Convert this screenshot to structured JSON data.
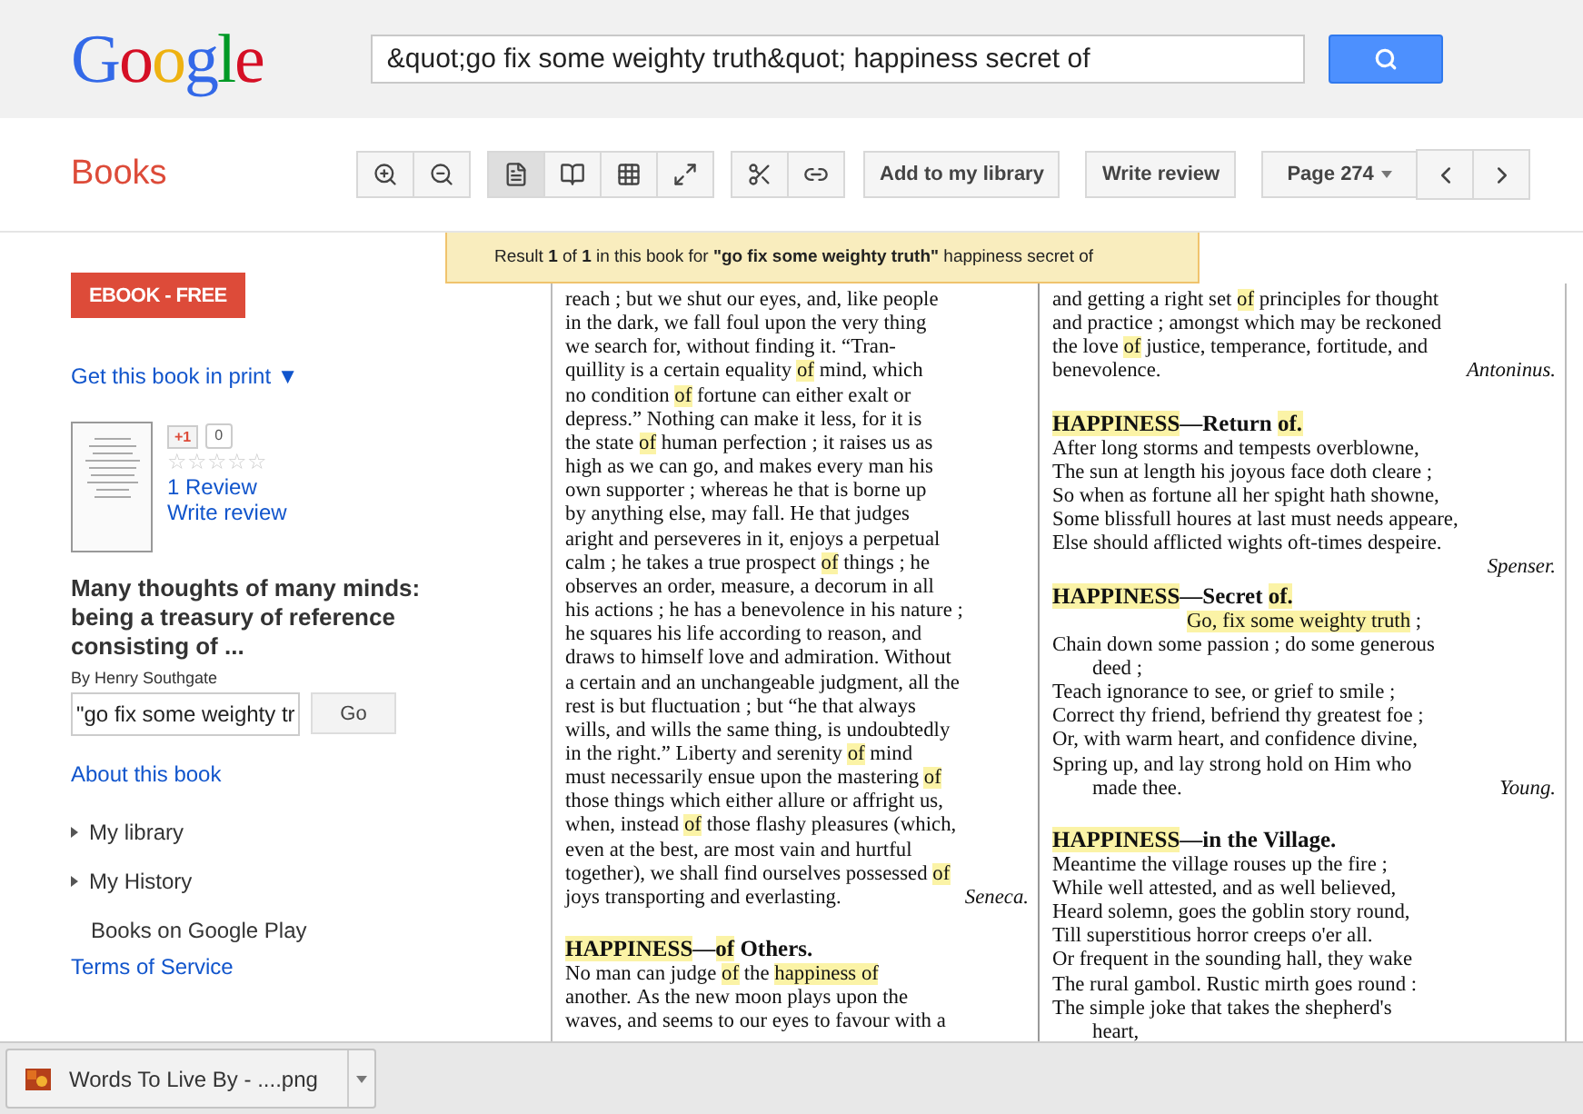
{
  "header": {
    "logo": "Google",
    "search": {
      "value": "&quot;go fix some weighty truth&quot; happiness secret of"
    }
  },
  "toolbar": {
    "title": "Books",
    "view_modes": [
      {
        "kind": "page",
        "selected": true
      },
      {
        "kind": "two-page",
        "selected": false
      },
      {
        "kind": "grid",
        "selected": false
      },
      {
        "kind": "fullscreen",
        "selected": false
      }
    ],
    "buttons": [
      "Add to my library",
      "Write review"
    ],
    "page_select": "Page 274"
  },
  "sidebar": {
    "ebook_button": "EBOOK - FREE",
    "get_print": "Get this book in print ▼",
    "plus_one": {
      "label": "+1",
      "count": "0"
    },
    "stars": 0,
    "review_count": "1 Review",
    "write_review": "Write review",
    "book_title": "Many thoughts of many minds: being a treasury of reference consisting of ...",
    "author": "By Henry Southgate",
    "search": {
      "value": "\"go fix some weighty tr",
      "button": "Go"
    },
    "about": "About this book",
    "menu": [
      {
        "label": "My library",
        "kind": "expander"
      },
      {
        "label": "My History",
        "kind": "expander"
      },
      {
        "label": "Books on Google Play",
        "kind": "plain"
      }
    ],
    "terms": "Terms of Service"
  },
  "result_banner": "Result **1** of **1** in this book for **\"go fix some weighty truth\"** happiness secret of",
  "page": {
    "columns": [
      [
        {
          "kind": "text",
          "text": [
            "reach ; but we shut our eyes, and, like people"
          ]
        },
        {
          "kind": "text",
          "text": [
            "in the dark, we fall foul upon the very thing"
          ]
        },
        {
          "kind": "text",
          "text": [
            "we search for, without finding it. “Tran-"
          ]
        },
        {
          "kind": "text",
          "text": [
            "quillity is a certain equality ",
            {
              "text": "of",
              "highlighted": true
            },
            " mind, which"
          ]
        },
        {
          "kind": "text",
          "text": [
            "no condition ",
            {
              "text": "of",
              "highlighted": true
            },
            " fortune can either exalt or"
          ]
        },
        {
          "kind": "text",
          "text": [
            "depress.” Nothing can make it less, for it is"
          ]
        },
        {
          "kind": "text",
          "text": [
            "the state ",
            {
              "text": "of",
              "highlighted": true
            },
            " human perfection ; it raises us as"
          ]
        },
        {
          "kind": "text",
          "text": [
            "high as we can go, and makes every man his"
          ]
        },
        {
          "kind": "text",
          "text": [
            "own supporter ; whereas he that is borne up"
          ]
        },
        {
          "kind": "text",
          "text": [
            "by anything else, may fall. He that judges"
          ]
        },
        {
          "kind": "text",
          "text": [
            "aright and perseveres in it, enjoys a perpetual"
          ]
        },
        {
          "kind": "text",
          "text": [
            "calm ; he takes a true prospect ",
            {
              "text": "of",
              "highlighted": true
            },
            " things ; he"
          ]
        },
        {
          "kind": "text",
          "text": [
            "observes an order, measure, a decorum in all"
          ]
        },
        {
          "kind": "text",
          "text": [
            "his actions ; he has a benevolence in his nature ;"
          ]
        },
        {
          "kind": "text",
          "text": [
            "he squares his life according to reason, and"
          ]
        },
        {
          "kind": "text",
          "text": [
            "draws to himself love and admiration. Without"
          ]
        },
        {
          "kind": "text",
          "text": [
            "a certain and an unchangeable judgment, all the"
          ]
        },
        {
          "kind": "text",
          "text": [
            "rest is but fluctuation ; but “he that always"
          ]
        },
        {
          "kind": "text",
          "text": [
            "wills, and wills the same thing, is undoubtedly"
          ]
        },
        {
          "kind": "text",
          "text": [
            "in the right.” Liberty and serenity ",
            {
              "text": "of",
              "highlighted": true
            },
            " mind"
          ]
        },
        {
          "kind": "text",
          "text": [
            "must necessarily ensue upon the mastering ",
            {
              "text": "of",
              "highlighted": true
            }
          ]
        },
        {
          "kind": "text",
          "text": [
            "those things which either allure or affright us,"
          ]
        },
        {
          "kind": "text",
          "text": [
            "when, instead ",
            {
              "text": "of",
              "highlighted": true
            },
            " those flashy pleasures (which,"
          ]
        },
        {
          "kind": "text",
          "text": [
            "even at the best, are most vain and hurtful"
          ]
        },
        {
          "kind": "text",
          "text": [
            "together), we shall find ourselves possessed ",
            {
              "text": "of",
              "highlighted": true
            }
          ]
        },
        {
          "kind": "text",
          "text": [
            "joys transporting and everlasting."
          ],
          "attribution": "Seneca."
        },
        {
          "kind": "gap"
        },
        {
          "kind": "heading",
          "text": [
            {
              "text": "HAPPINESS",
              "highlighted": true
            },
            "—",
            {
              "text": "of",
              "highlighted": true
            },
            " Others."
          ]
        },
        {
          "kind": "text",
          "text": [
            "No man can judge ",
            {
              "text": "of",
              "highlighted": true
            },
            " the ",
            {
              "text": "happiness of",
              "highlighted": true
            }
          ]
        },
        {
          "kind": "text",
          "text": [
            "another. As the new moon plays upon the"
          ]
        },
        {
          "kind": "text",
          "text": [
            "waves, and seems to our eyes to favour with a"
          ]
        }
      ],
      [
        {
          "kind": "text",
          "text": [
            "and getting a right set ",
            {
              "text": "of",
              "highlighted": true
            },
            " principles for thought"
          ]
        },
        {
          "kind": "text",
          "text": [
            "and practice ; amongst which may be reckoned"
          ]
        },
        {
          "kind": "text",
          "text": [
            "the love ",
            {
              "text": "of",
              "highlighted": true
            },
            " justice, temperance, fortitude, and"
          ]
        },
        {
          "kind": "text",
          "text": [
            "benevolence."
          ],
          "attribution": "Antoninus."
        },
        {
          "kind": "gap"
        },
        {
          "kind": "heading",
          "text": [
            {
              "text": "HAPPINESS",
              "highlighted": true
            },
            "—Return ",
            {
              "text": "of.",
              "highlighted": true
            }
          ]
        },
        {
          "kind": "text",
          "text": [
            "After long storms and tempests overblowne,"
          ]
        },
        {
          "kind": "text",
          "text": [
            "The sun at length his joyous face doth cleare ;"
          ]
        },
        {
          "kind": "text",
          "text": [
            "So when as fortune all her spight hath showne,"
          ]
        },
        {
          "kind": "text",
          "text": [
            "Some blissfull houres at last must needs appeare,"
          ]
        },
        {
          "kind": "text",
          "text": [
            "Else should afflicted wights oft-times despeire."
          ]
        },
        {
          "kind": "attribution",
          "text": [
            "Spenser."
          ]
        },
        {
          "kind": "heading",
          "text": [
            {
              "text": "HAPPINESS",
              "highlighted": true
            },
            "—Secret ",
            {
              "text": "of.",
              "highlighted": true
            }
          ]
        },
        {
          "kind": "center",
          "text": [
            {
              "text": "Go, fix some weighty truth",
              "highlighted": true
            },
            " ;"
          ]
        },
        {
          "kind": "text",
          "text": [
            "Chain down some passion ; do some generous"
          ]
        },
        {
          "kind": "indent",
          "text": [
            "deed ;"
          ]
        },
        {
          "kind": "text",
          "text": [
            "Teach ignorance to see, or grief to smile ;"
          ]
        },
        {
          "kind": "text",
          "text": [
            "Correct thy friend, befriend thy greatest foe ;"
          ]
        },
        {
          "kind": "text",
          "text": [
            "Or, with warm heart, and confidence divine,"
          ]
        },
        {
          "kind": "text",
          "text": [
            "Spring up, and lay strong hold on Him who"
          ]
        },
        {
          "kind": "indent",
          "text": [
            "made thee."
          ],
          "attribution": "Young."
        },
        {
          "kind": "gap"
        },
        {
          "kind": "heading",
          "text": [
            {
              "text": "HAPPINESS",
              "highlighted": true
            },
            "—in the Village."
          ]
        },
        {
          "kind": "text",
          "text": [
            "Meantime the village rouses up the fire ;"
          ]
        },
        {
          "kind": "text",
          "text": [
            "While well attested, and as well believed,"
          ]
        },
        {
          "kind": "text",
          "text": [
            "Heard solemn, goes the goblin story round,"
          ]
        },
        {
          "kind": "text",
          "text": [
            "Till superstitious horror creeps o'er all."
          ]
        },
        {
          "kind": "text",
          "text": [
            "Or frequent in the sounding hall, they wake"
          ]
        },
        {
          "kind": "text",
          "text": [
            "The rural gambol. Rustic mirth goes round :"
          ]
        },
        {
          "kind": "text",
          "text": [
            "The simple joke that takes the shepherd's"
          ]
        },
        {
          "kind": "indent",
          "text": [
            "heart,"
          ]
        }
      ]
    ]
  },
  "download_bar": {
    "file": "Words To Live By - ....png"
  }
}
